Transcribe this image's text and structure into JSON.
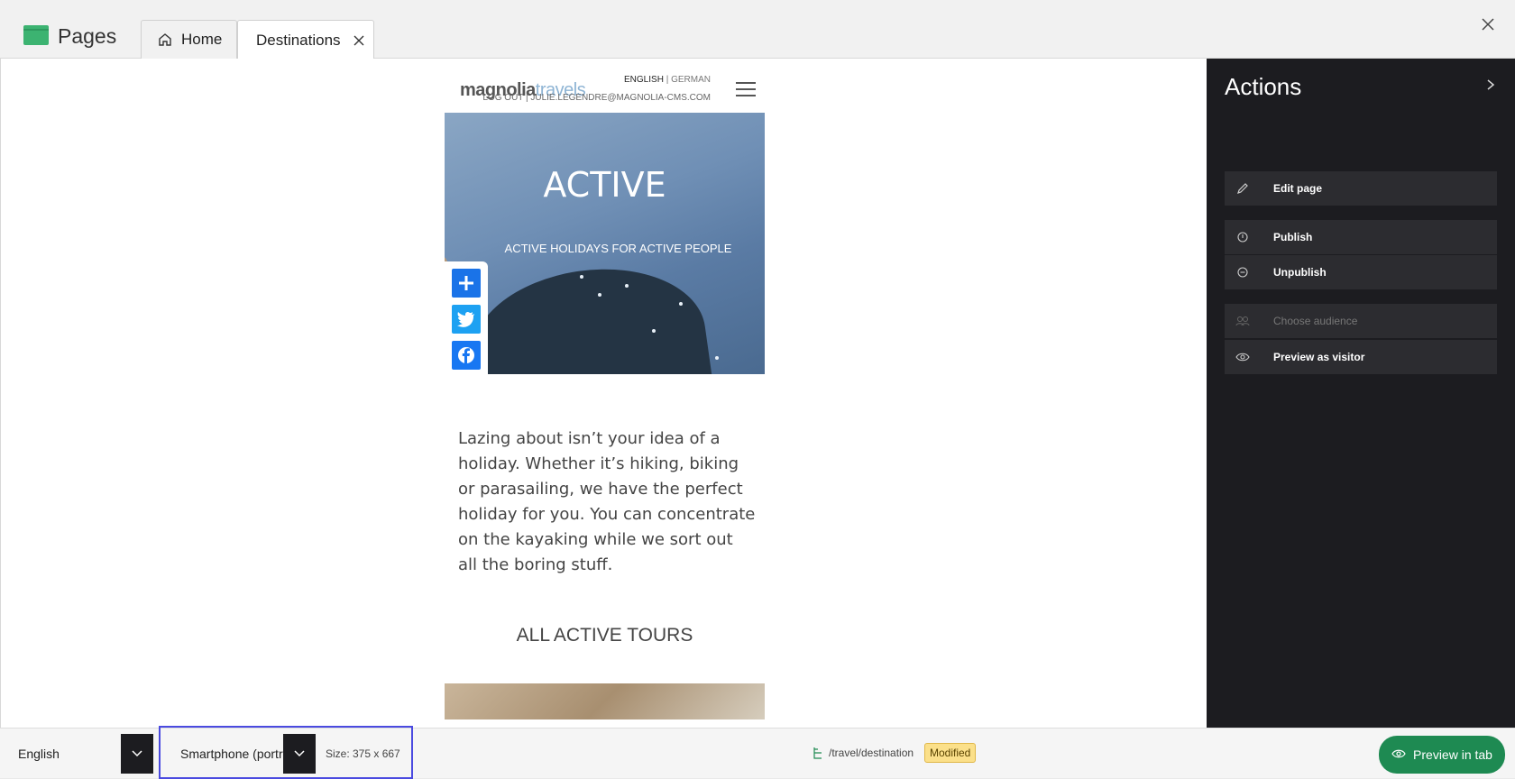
{
  "app": {
    "title": "Pages"
  },
  "tabs": [
    {
      "label": "Home",
      "icon": "home-icon"
    },
    {
      "label": "Destinations",
      "icon": "close-icon"
    }
  ],
  "site": {
    "logo_a": "magnolia",
    "logo_b": "travels",
    "lang_en": "ENGLISH",
    "lang_sep": "|",
    "lang_de": "GERMAN",
    "userline": "LOG OUT | JULIE.LEGENDRE@MAGNOLIA-CMS.COM",
    "hero_title": "ACTIVE",
    "hero_subtitle": "ACTIVE HOLIDAYS FOR ACTIVE PEOPLE",
    "intro": "Lazing about isn’t your idea of a holiday. Whether it’s hiking, biking or parasailing, we have the perfect holiday for you. You can concentrate on the kayaking while we sort out all the boring stuff.",
    "tours_heading": "ALL ACTIVE TOURS",
    "share_icons": [
      "add-icon",
      "twitter-icon",
      "facebook-icon"
    ]
  },
  "actions": {
    "title": "Actions",
    "items": [
      {
        "label": "Edit page",
        "icon": "pencil-icon",
        "enabled": true
      },
      {
        "label": "Publish",
        "icon": "publish-icon",
        "enabled": true
      },
      {
        "label": "Unpublish",
        "icon": "unpublish-icon",
        "enabled": true
      },
      {
        "label": "Choose audience",
        "icon": "audience-icon",
        "enabled": false
      },
      {
        "label": "Preview as visitor",
        "icon": "eye-icon",
        "enabled": true
      }
    ]
  },
  "footer": {
    "language": "English",
    "device": "Smartphone (portrait)",
    "size": "Size: 375 x 667",
    "path": "/travel/destination",
    "status": "Modified",
    "preview_button": "Preview in tab"
  },
  "colors": {
    "accent_green": "#1e8a52",
    "panel_dark": "#1c1c20",
    "focus_blue": "#4a4ae0",
    "badge_yellow": "#fbe08a"
  }
}
